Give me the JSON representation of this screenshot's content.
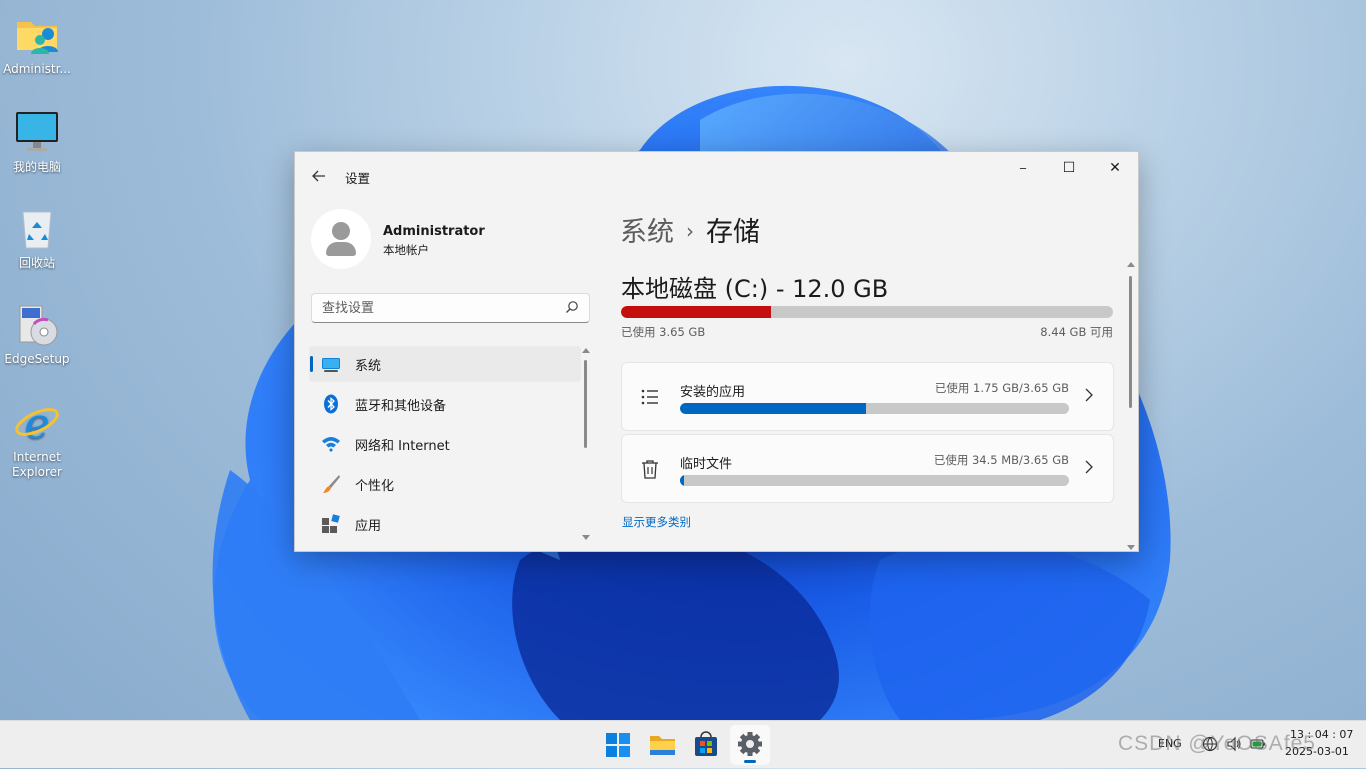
{
  "desktop": {
    "icons": [
      {
        "label": "Administr..."
      },
      {
        "label": "我的电脑"
      },
      {
        "label": "回收站"
      },
      {
        "label": "EdgeSetup"
      },
      {
        "label": "Internet Explorer"
      }
    ]
  },
  "window": {
    "app_title": "设置",
    "caption": {
      "minimize": "─",
      "maximize": "☐",
      "close": "✕"
    },
    "profile": {
      "name": "Administrator",
      "subtitle": "本地帐户"
    },
    "search": {
      "placeholder": "查找设置"
    },
    "nav": [
      {
        "label": "系统",
        "icon": "monitor-icon",
        "active": true
      },
      {
        "label": "蓝牙和其他设备",
        "icon": "bluetooth-icon"
      },
      {
        "label": "网络和 Internet",
        "icon": "wifi-icon"
      },
      {
        "label": "个性化",
        "icon": "brush-icon"
      },
      {
        "label": "应用",
        "icon": "apps-icon"
      }
    ],
    "breadcrumb": {
      "parent": "系统",
      "separator": "›",
      "current": "存储"
    },
    "disk": {
      "title": "本地磁盘 (C:) - 12.0 GB",
      "used_label": "已使用 3.65 GB",
      "free_label": "8.44 GB 可用",
      "used_fraction": 0.304
    },
    "categories": [
      {
        "label": "安装的应用",
        "usage": "已使用 1.75 GB/3.65 GB",
        "fraction": 0.479,
        "icon": "list-icon"
      },
      {
        "label": "临时文件",
        "usage": "已使用 34.5 MB/3.65 GB",
        "fraction": 0.01,
        "icon": "trash-icon"
      }
    ],
    "more_link": "显示更多类别"
  },
  "taskbar": {
    "lang": "ENG",
    "time": "13 : 04 : 07",
    "date": "2025-03-01"
  },
  "watermark": "CSDN @YoOSAfe5",
  "colors": {
    "accent": "#0067c0",
    "disk_used": "#c50f0f",
    "bar_bg": "#c8c8c8"
  }
}
